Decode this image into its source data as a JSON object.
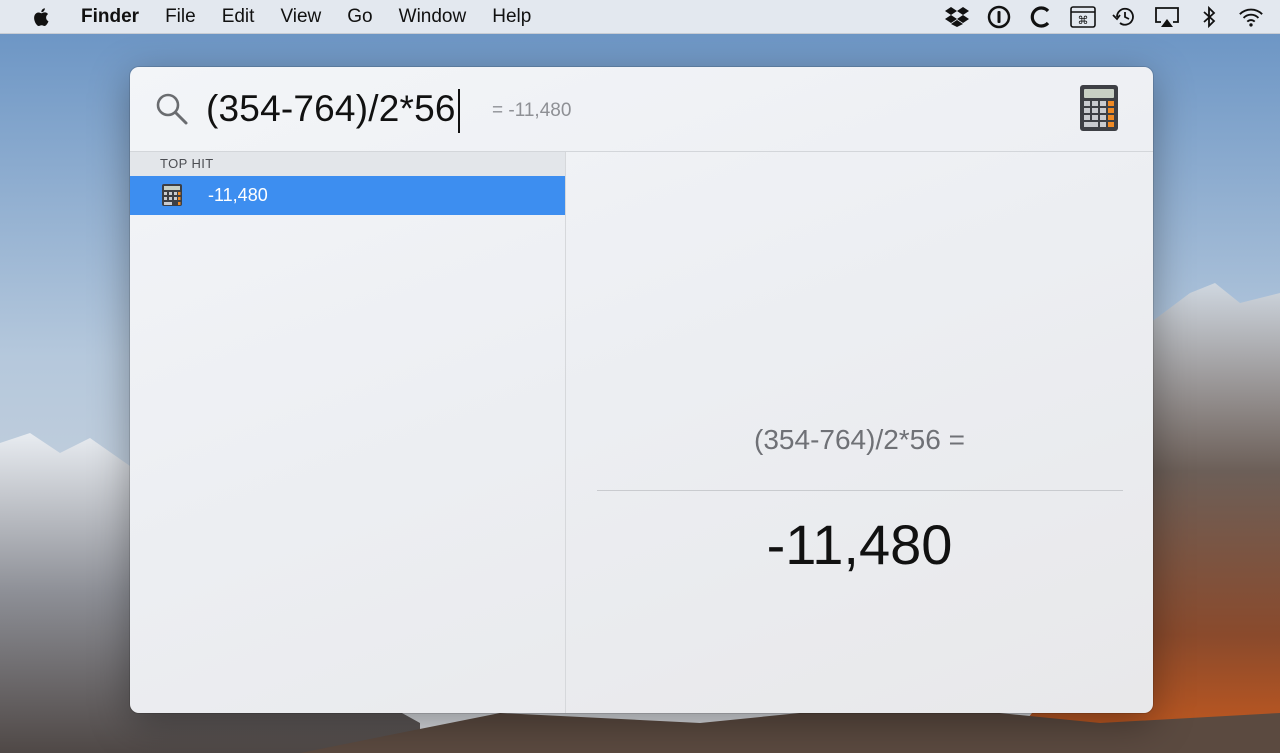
{
  "menubar": {
    "items": [
      "Finder",
      "File",
      "Edit",
      "View",
      "Go",
      "Window",
      "Help"
    ],
    "status_icons": [
      "dropbox-icon",
      "onepassword-icon",
      "ccleaner-icon",
      "keyboard-shortcut-icon",
      "time-machine-icon",
      "airplay-icon",
      "bluetooth-icon",
      "wifi-icon"
    ]
  },
  "spotlight": {
    "query": "(354-764)/2*56",
    "inline_result": "= -11,480",
    "section_header": "TOP HIT",
    "top_hit": {
      "label": "-11,480",
      "icon": "calculator-icon"
    },
    "preview": {
      "expression": "(354-764)/2*56 =",
      "result": "-11,480"
    }
  },
  "colors": {
    "selection": "#3d8ef0",
    "menubar": "#eceef2"
  }
}
